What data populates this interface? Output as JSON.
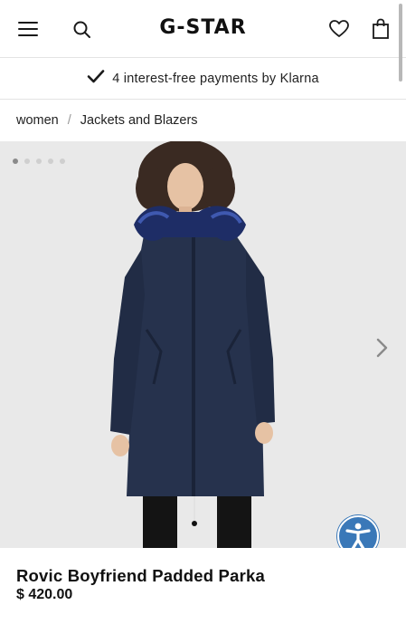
{
  "header": {
    "logo": "G-STAR",
    "menu_icon": "hamburger-menu-icon",
    "search_icon": "search-icon",
    "wishlist_icon": "heart-icon",
    "bag_icon": "shopping-bag-icon"
  },
  "promo": {
    "icon": "checkmark-icon",
    "text": "4 interest-free payments by Klarna"
  },
  "breadcrumb": {
    "items": [
      "women",
      "Jackets and Blazers"
    ],
    "separator": "/"
  },
  "gallery": {
    "image_count": 5,
    "active_index": 0,
    "next_icon": "chevron-right-icon",
    "background": "#e9e9e9"
  },
  "accessibility": {
    "icon": "accessibility-icon",
    "color": "#3a78b8"
  },
  "product": {
    "name": "Rovic Boyfriend Padded Parka",
    "price": "$ 420.00"
  }
}
